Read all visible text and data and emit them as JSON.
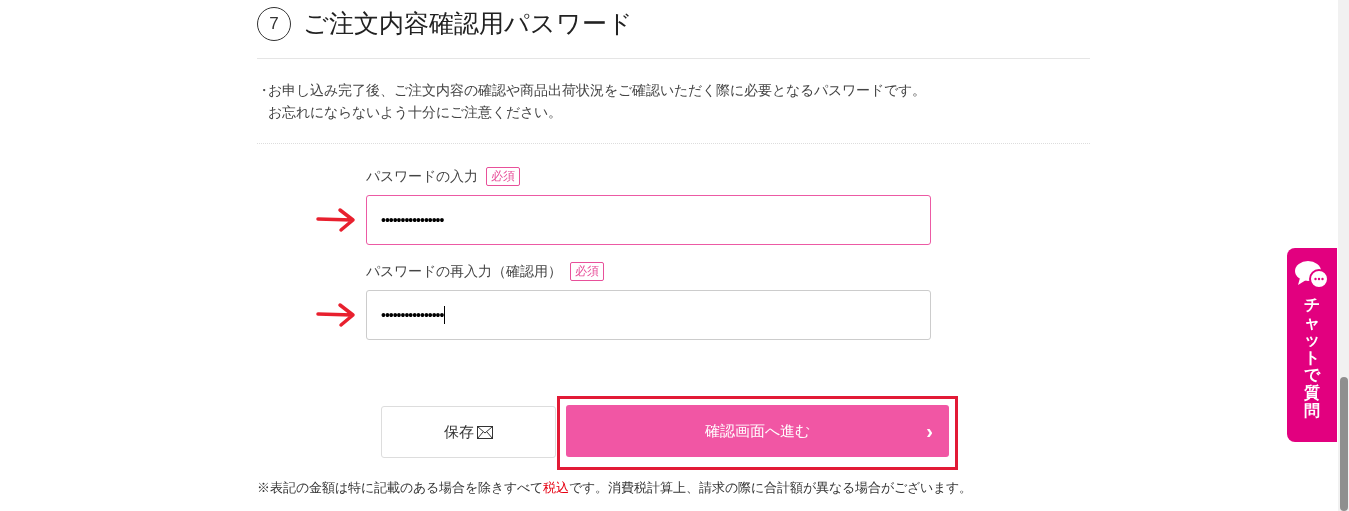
{
  "section": {
    "number": "7",
    "title": "ご注文内容確認用パスワード"
  },
  "notice": {
    "bullet": "・",
    "lines": [
      "お申し込み完了後、ご注文内容の確認や商品出荷状況をご確認いただく際に必要となるパスワードです。",
      "お忘れにならないよう十分にご注意ください。"
    ]
  },
  "fields": [
    {
      "label": "パスワードの入力",
      "badge": "必須",
      "value": "••••••••••••••••",
      "focused": true,
      "cursor": false
    },
    {
      "label": "パスワードの再入力（確認用）",
      "badge": "必須",
      "value": "••••••••••••••••",
      "focused": false,
      "cursor": true
    }
  ],
  "buttons": {
    "save": {
      "label": "保存"
    },
    "next": {
      "label": "確認画面へ進む",
      "arrow": "›"
    }
  },
  "footnote": {
    "before": "※表記の金額は特に記載のある場合を除きすべて",
    "highlight": "税込",
    "after": "です。消費税計算上、請求の際に合計額が異なる場合がございます。"
  },
  "chat_tab": {
    "label": "チャットで質問"
  }
}
